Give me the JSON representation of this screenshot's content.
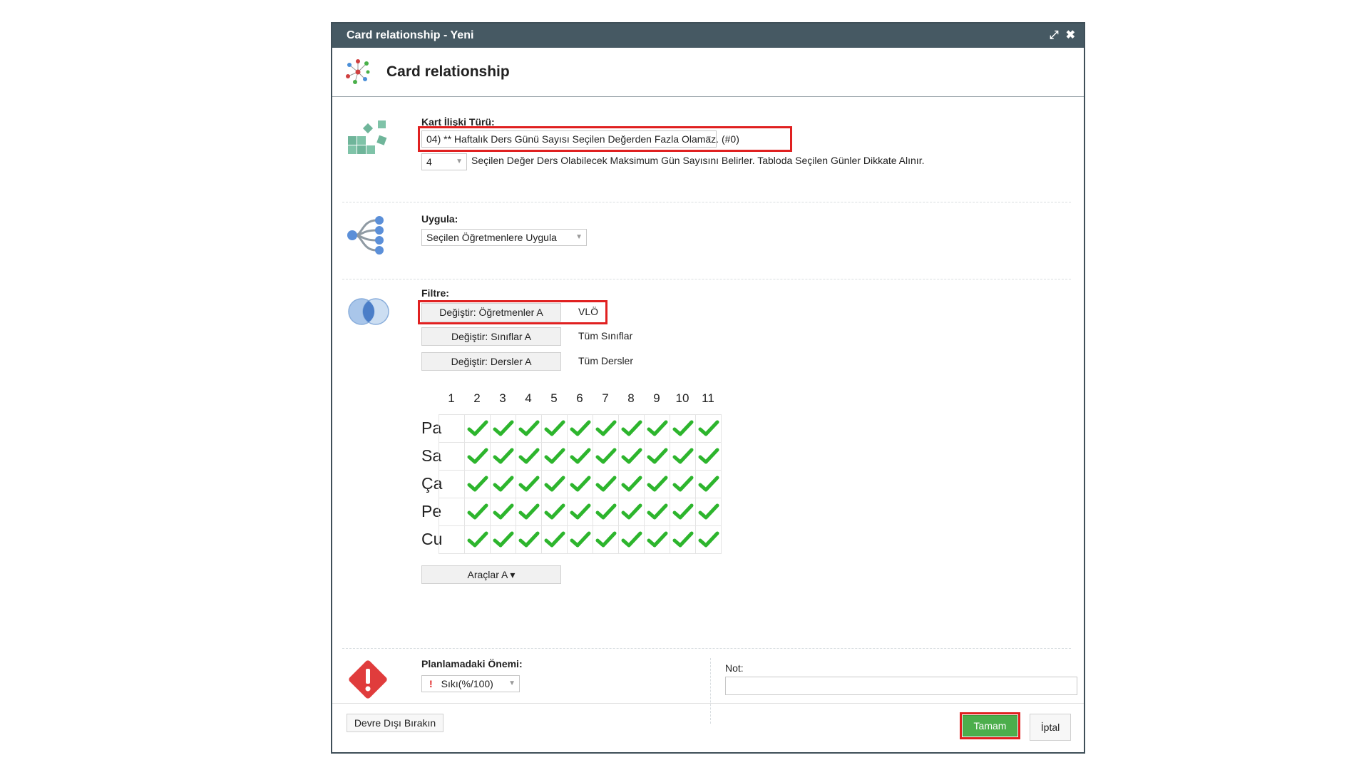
{
  "window": {
    "title": "Card relationship - Yeni",
    "maximize_icon": "expand-icon",
    "close_icon": "close-icon"
  },
  "header": {
    "title": "Card relationship"
  },
  "relation": {
    "label": "Kart İlişki Türü:",
    "selected": "04) ** Haftalık Ders Günü Sayısı Seçilen Değerden Fazla Olamaz. (#0)",
    "value": "4",
    "description": "Seçilen Değer Ders Olabilecek Maksimum Gün Sayısını Belirler. Tabloda Seçilen Günler Dikkate Alınır."
  },
  "apply": {
    "label": "Uygula:",
    "selected": "Seçilen Öğretmenlere Uygula"
  },
  "filter": {
    "label": "Filtre:",
    "rows": [
      {
        "button": "Değiştir: Öğretmenler A",
        "value": "VLÖ"
      },
      {
        "button": "Değiştir: Sınıflar A",
        "value": "Tüm Sınıflar"
      },
      {
        "button": "Değiştir: Dersler A",
        "value": "Tüm Dersler"
      }
    ]
  },
  "schedule": {
    "columns": [
      "1",
      "2",
      "3",
      "4",
      "5",
      "6",
      "7",
      "8",
      "9",
      "10",
      "11"
    ],
    "days": [
      "Pa",
      "Sa",
      "Ça",
      "Pe",
      "Cu"
    ],
    "checked_from_column": 2,
    "check_color": "#2db52d"
  },
  "tools_button": "Araçlar A ▾",
  "importance": {
    "label": "Planlamadaki Önemi:",
    "selected": "Sıkı(%/100)",
    "marker": "!"
  },
  "note": {
    "label": "Not:",
    "value": ""
  },
  "footer": {
    "disable_label": "Devre Dışı Bırakın",
    "ok_label": "Tamam",
    "cancel_label": "İptal"
  },
  "colors": {
    "titlebar": "#465963",
    "ok_button": "#4cae4c",
    "highlight": "#e02020",
    "warning": "#e03c3c"
  }
}
